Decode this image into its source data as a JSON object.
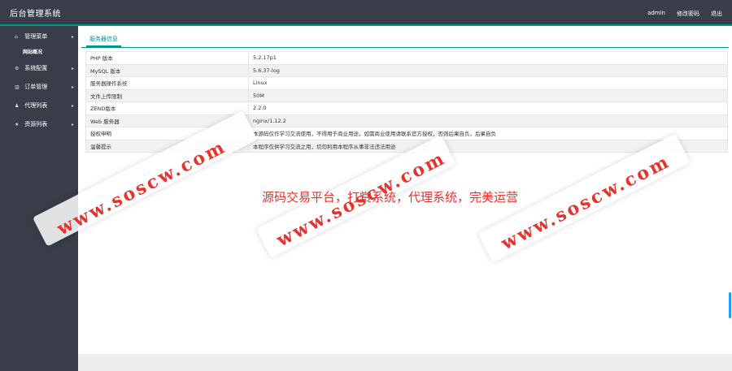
{
  "header": {
    "title": "后台管理系统",
    "links": [
      "admin",
      "修改密码",
      "退出"
    ]
  },
  "sidebar": {
    "items": [
      {
        "icon": "home-icon",
        "label": "管理菜单"
      },
      {
        "icon": "gears-icon",
        "label": "系统配置"
      },
      {
        "icon": "chart-icon",
        "label": "订单管理"
      },
      {
        "icon": "user-icon",
        "label": "代理列表"
      },
      {
        "icon": "star-icon",
        "label": "资源列表"
      }
    ],
    "subitem": "网站概况"
  },
  "tab": {
    "label": "服务器信息"
  },
  "table": {
    "rows": [
      {
        "k": "PHP 版本",
        "v": "5.2.17p1"
      },
      {
        "k": "MySQL 版本",
        "v": "5.6.37-log"
      },
      {
        "k": "服务器操作系统",
        "v": "Linux"
      },
      {
        "k": "文件上传限制",
        "v": "50M"
      },
      {
        "k": "ZEND版本",
        "v": "2.2.0"
      },
      {
        "k": "Web 服务器",
        "v": "nginx/1.12.2"
      },
      {
        "k": "授权申明",
        "v": "本源码仅作学习交流使用，不得用于商业用途，如需商业使用请联系官方授权，否则后果自负，后果自负"
      },
      {
        "k": "温馨提示",
        "v": "本程序仅供学习交流之用，切勿利用本程序从事非法违法用途"
      }
    ]
  },
  "watermark": {
    "text": "www.soscw.com",
    "line": "源码交易平台，打赏系统，代理系统，完美运营",
    "color": "#e8322d"
  },
  "colors": {
    "header_bg": "#393d49",
    "accent": "#009688",
    "scroll_thumb": "#1e9fff"
  }
}
